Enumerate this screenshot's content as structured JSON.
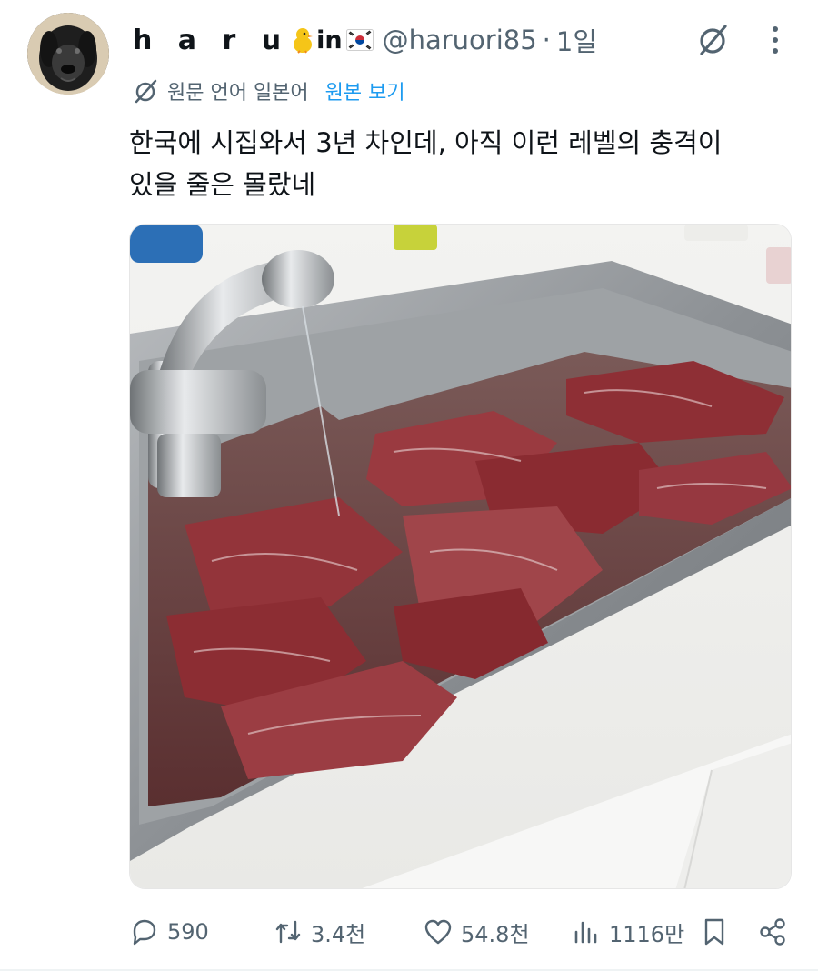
{
  "post": {
    "display_name": "h a r u",
    "name_suffix": "in",
    "handle": "@haruori85",
    "separator": "·",
    "time": "1일",
    "translation_note": "원문 언어 일본어",
    "translation_link": "원본 보기",
    "text_line1": "한국에 시집와서 3년 차인데, 아직 이런 레벨의 충격이",
    "text_line2": "있을 줄은 몰랐네"
  },
  "actions": {
    "replies": "590",
    "reposts": "3.4천",
    "likes": "54.8천",
    "views": "1116만"
  },
  "icons": {
    "avatar": "dog-avatar",
    "grok": "grok-icon",
    "more": "more-vertical-icon",
    "translate": "translate-icon",
    "reply": "reply-icon",
    "repost": "repost-icon",
    "like": "heart-icon",
    "views": "views-chart-icon",
    "bookmark": "bookmark-icon",
    "share": "share-icon"
  },
  "colors": {
    "text_primary": "#0f1419",
    "text_secondary": "#536471",
    "link": "#1d9bf0"
  }
}
